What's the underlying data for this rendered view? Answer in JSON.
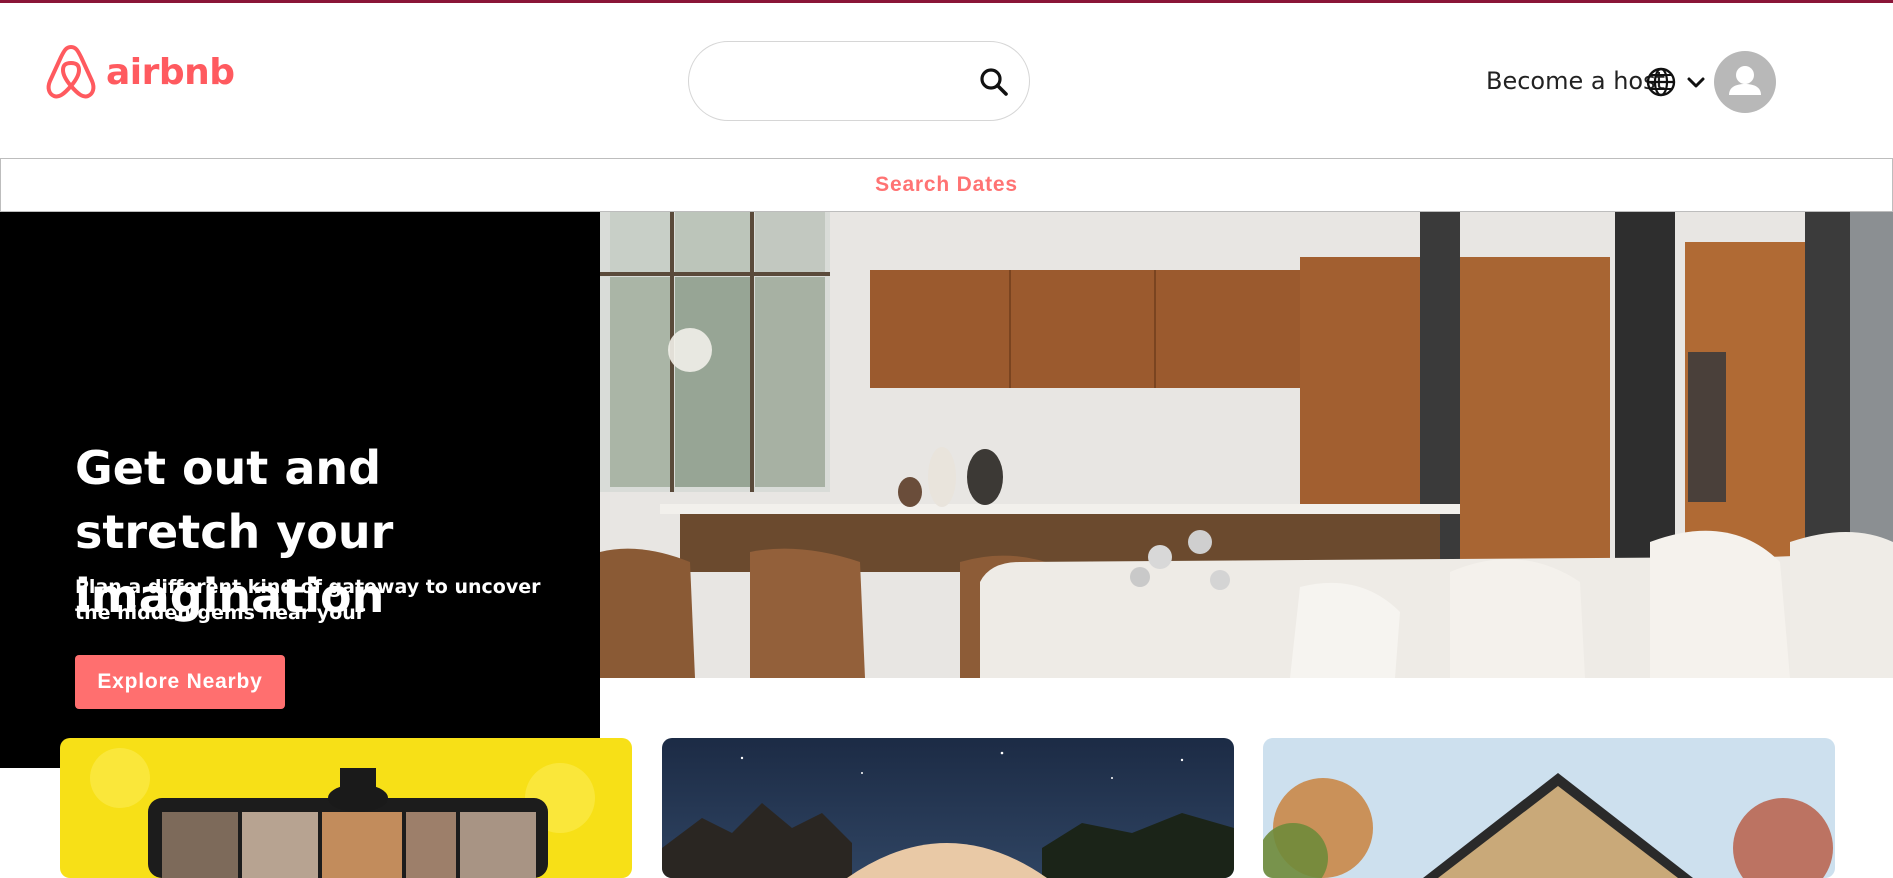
{
  "brand": {
    "name": "airbnb",
    "accent_color": "#ff5a5f",
    "logo_icon": "airbnb-belo-icon"
  },
  "header": {
    "search": {
      "value": "",
      "placeholder": "",
      "icon": "search-icon"
    },
    "host_link_label": "Become a host",
    "language_icon": "globe-icon",
    "menu_icon": "chevron-down-icon",
    "avatar_icon": "user-avatar-icon"
  },
  "dates_bar": {
    "label": "Search Dates",
    "color": "#ff7373"
  },
  "hero": {
    "title": "Get out and stretch your imagination",
    "subtitle": "Plan a different kind of gateway to uncover the hidden gems near your",
    "cta_label": "Explore Nearby",
    "cta_color": "#ff6f6f",
    "panel_color": "#000000",
    "image": "modern-kitchen-living-room-photo"
  },
  "cards": [
    {
      "image": "online-experience-video-call-photo"
    },
    {
      "image": "geodesic-dome-night-sky-photo"
    },
    {
      "image": "a-frame-house-photo"
    }
  ]
}
